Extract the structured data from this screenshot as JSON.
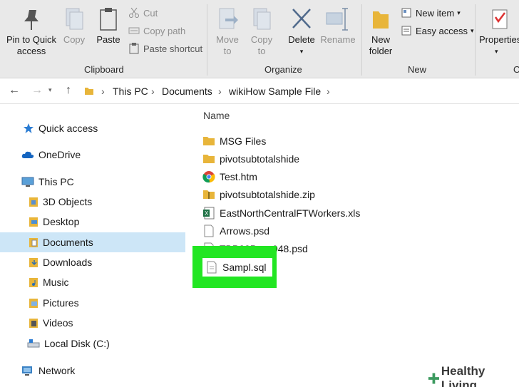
{
  "ribbon": {
    "clipboard": {
      "pin_label": "Pin to Quick",
      "pin_label_2": "access",
      "copy_label": "Copy",
      "paste_label": "Paste",
      "cut_label": "Cut",
      "copy_path_label": "Copy path",
      "paste_shortcut_label": "Paste shortcut",
      "group_label": "Clipboard"
    },
    "organize": {
      "move_to_label": "Move",
      "move_to_label_2": "to",
      "copy_to_label": "Copy",
      "copy_to_label_2": "to",
      "delete_label": "Delete",
      "rename_label": "Rename",
      "group_label": "Organize"
    },
    "new": {
      "new_folder_label": "New",
      "new_folder_label_2": "folder",
      "new_item_label": "New item",
      "easy_access_label": "Easy access",
      "group_label": "New"
    },
    "open": {
      "properties_label": "Properties",
      "group_label": "O"
    }
  },
  "address": {
    "crumbs": [
      "This PC",
      "Documents",
      "wikiHow Sample File"
    ]
  },
  "nav": {
    "items": [
      {
        "label": "Quick access",
        "icon": "star-icon"
      },
      {
        "label": "OneDrive",
        "icon": "cloud-icon"
      },
      {
        "label": "This PC",
        "icon": "computer-icon"
      },
      {
        "label": "3D Objects",
        "icon": "folder-3d-icon"
      },
      {
        "label": "Desktop",
        "icon": "folder-desktop-icon"
      },
      {
        "label": "Documents",
        "icon": "folder-documents-icon"
      },
      {
        "label": "Downloads",
        "icon": "folder-downloads-icon"
      },
      {
        "label": "Music",
        "icon": "folder-music-icon"
      },
      {
        "label": "Pictures",
        "icon": "folder-pictures-icon"
      },
      {
        "label": "Videos",
        "icon": "folder-videos-icon"
      },
      {
        "label": "Local Disk (C:)",
        "icon": "disk-icon"
      },
      {
        "label": "Network",
        "icon": "network-icon"
      }
    ]
  },
  "main": {
    "column_header": "Name",
    "files": [
      {
        "name": "MSG Files",
        "icon": "folder-icon"
      },
      {
        "name": "pivotsubtotalshide",
        "icon": "folder-icon"
      },
      {
        "name": "Test.htm",
        "icon": "chrome-icon"
      },
      {
        "name": "pivotsubtotalshide.zip",
        "icon": "zip-folder-icon"
      },
      {
        "name": "EastNorthCentralFTWorkers.xls",
        "icon": "excel-icon"
      },
      {
        "name": "Arrows.psd",
        "icon": "file-icon"
      },
      {
        "name": "TBP225___948.psd",
        "icon": "file-icon"
      },
      {
        "name": "Sampl.sql",
        "icon": "file-icon"
      }
    ]
  },
  "watermark": "Healthy Living",
  "colors": {
    "highlight": "#22e622",
    "selection": "#cde6f7",
    "folder": "#e8b53a"
  }
}
